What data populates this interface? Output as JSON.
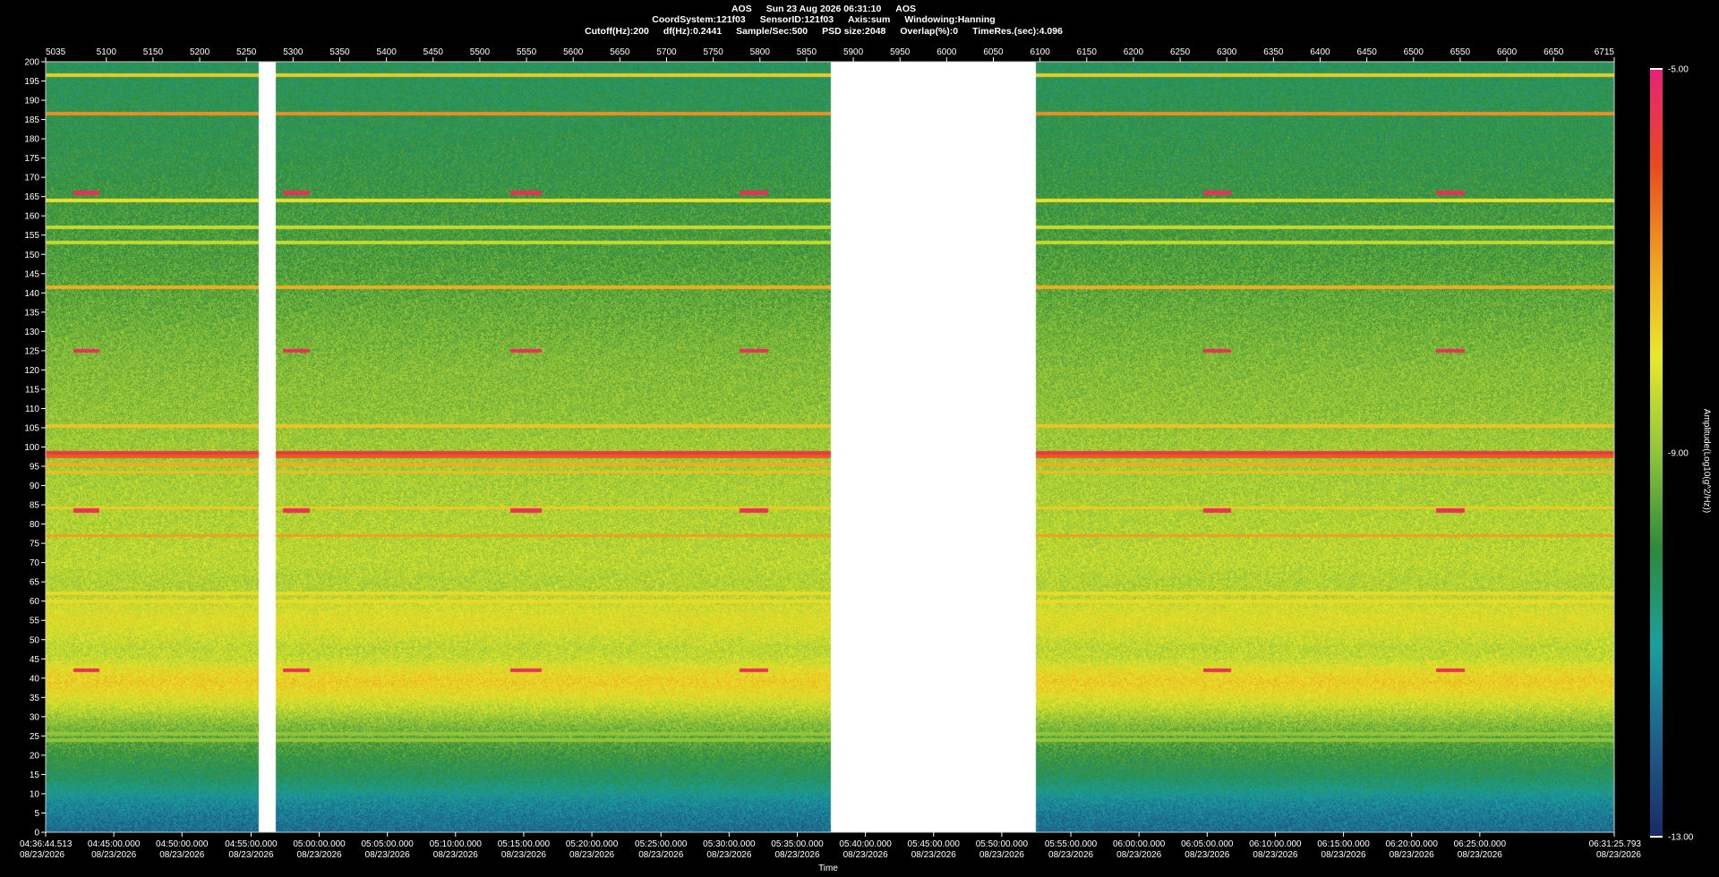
{
  "header": {
    "line1": [
      "AOS",
      "Sun 23 Aug 2026 06:31:10",
      "AOS"
    ],
    "line2": [
      "CoordSystem:121f03",
      "SensorID:121f03",
      "Axis:sum",
      "Windowing:Hanning"
    ],
    "line3": [
      "Cutoff(Hz):200",
      "df(Hz):0.2441",
      "Sample/Sec:500",
      "PSD size:2048",
      "Overlap(%):0",
      "TimeRes.(sec):4.096"
    ]
  },
  "colorbar": {
    "title": "Amplitude(Log10(g^2/Hz))",
    "max_label": "-5.00",
    "mid_label": "-9.00",
    "min_label": "-13.00",
    "stops": [
      "#1a2a66",
      "#1e5f8a",
      "#1aa0a0",
      "#2e8a3a",
      "#8fc43a",
      "#e8e82a",
      "#f0a020",
      "#e84a20",
      "#e8207a"
    ]
  },
  "chart_data": {
    "type": "heatmap",
    "title": "",
    "xlabel": "Time",
    "ylabel": "",
    "ylim": [
      0,
      200
    ],
    "xlim_index": [
      5035,
      6715
    ],
    "y_ticks": [
      0,
      5,
      10,
      15,
      20,
      25,
      30,
      35,
      40,
      45,
      50,
      55,
      60,
      65,
      70,
      75,
      80,
      85,
      90,
      95,
      100,
      105,
      110,
      115,
      120,
      125,
      130,
      135,
      140,
      145,
      150,
      155,
      160,
      165,
      170,
      175,
      180,
      185,
      190,
      195,
      200
    ],
    "top_ticks": [
      5035,
      5100,
      5150,
      5200,
      5250,
      5300,
      5350,
      5400,
      5450,
      5500,
      5550,
      5600,
      5650,
      5700,
      5750,
      5800,
      5850,
      5900,
      5950,
      6000,
      6050,
      6100,
      6150,
      6200,
      6250,
      6300,
      6350,
      6400,
      6450,
      6500,
      6550,
      6600,
      6650,
      6715
    ],
    "bottom_ticks": [
      {
        "index": 5035,
        "time": "04:36:44.513",
        "date": "08/23/2026"
      },
      {
        "index": 5108,
        "time": "04:45:00.000",
        "date": "08/23/2026"
      },
      {
        "index": 5181,
        "time": "04:50:00.000",
        "date": "08/23/2026"
      },
      {
        "index": 5255,
        "time": "04:55:00.000",
        "date": "08/23/2026"
      },
      {
        "index": 5328,
        "time": "05:00:00.000",
        "date": "08/23/2026"
      },
      {
        "index": 5401,
        "time": "05:05:00.000",
        "date": "08/23/2026"
      },
      {
        "index": 5474,
        "time": "05:10:00.000",
        "date": "08/23/2026"
      },
      {
        "index": 5547,
        "time": "05:15:00.000",
        "date": "08/23/2026"
      },
      {
        "index": 5620,
        "time": "05:20:00.000",
        "date": "08/23/2026"
      },
      {
        "index": 5694,
        "time": "05:25:00.000",
        "date": "08/23/2026"
      },
      {
        "index": 5767,
        "time": "05:30:00.000",
        "date": "08/23/2026"
      },
      {
        "index": 5840,
        "time": "05:35:00.000",
        "date": "08/23/2026"
      },
      {
        "index": 5913,
        "time": "05:40:00.000",
        "date": "08/23/2026"
      },
      {
        "index": 5986,
        "time": "05:45:00.000",
        "date": "08/23/2026"
      },
      {
        "index": 6059,
        "time": "05:50:00.000",
        "date": "08/23/2026"
      },
      {
        "index": 6133,
        "time": "05:55:00.000",
        "date": "08/23/2026"
      },
      {
        "index": 6206,
        "time": "06:00:00.000",
        "date": "08/23/2026"
      },
      {
        "index": 6279,
        "time": "06:05:00.000",
        "date": "08/23/2026"
      },
      {
        "index": 6352,
        "time": "06:10:00.000",
        "date": "08/23/2026"
      },
      {
        "index": 6425,
        "time": "06:15:00.000",
        "date": "08/23/2026"
      },
      {
        "index": 6498,
        "time": "06:20:00.000",
        "date": "08/23/2026"
      },
      {
        "index": 6571,
        "time": "06:25:00.000",
        "date": "08/23/2026"
      },
      {
        "index": 6715,
        "time": "06:31:25.793",
        "date": "08/23/2026"
      }
    ],
    "gaps_index": [
      [
        5263,
        5281
      ],
      [
        5876,
        6096
      ]
    ],
    "spectrum_profile_hz": [
      [
        0,
        -11.8
      ],
      [
        4,
        -11.6
      ],
      [
        8,
        -11.3
      ],
      [
        12,
        -10.6
      ],
      [
        16,
        -10.2
      ],
      [
        20,
        -9.9
      ],
      [
        24,
        -9.5
      ],
      [
        28,
        -9.1
      ],
      [
        32,
        -8.5
      ],
      [
        36,
        -7.9
      ],
      [
        39,
        -7.6
      ],
      [
        42,
        -7.9
      ],
      [
        45,
        -8.4
      ],
      [
        48,
        -8.5
      ],
      [
        52,
        -8.2
      ],
      [
        55,
        -8.0
      ],
      [
        58,
        -8.2
      ],
      [
        62,
        -8.6
      ],
      [
        66,
        -8.6
      ],
      [
        70,
        -8.5
      ],
      [
        80,
        -8.6
      ],
      [
        90,
        -8.7
      ],
      [
        100,
        -8.8
      ],
      [
        110,
        -9.0
      ],
      [
        120,
        -9.1
      ],
      [
        130,
        -9.3
      ],
      [
        140,
        -9.5
      ],
      [
        150,
        -9.7
      ],
      [
        160,
        -9.8
      ],
      [
        170,
        -10.0
      ],
      [
        180,
        -10.1
      ],
      [
        190,
        -10.2
      ],
      [
        200,
        -10.3
      ]
    ],
    "lines_hz": [
      {
        "hz": 98.5,
        "level": -5.6
      },
      {
        "hz": 97.6,
        "level": -6.2
      },
      {
        "hz": 95.5,
        "level": -7.2
      },
      {
        "hz": 93.5,
        "level": -7.4
      },
      {
        "hz": 186.5,
        "level": -6.8
      },
      {
        "hz": 196.5,
        "level": -7.6
      },
      {
        "hz": 141.5,
        "level": -7.2
      },
      {
        "hz": 164.0,
        "level": -7.9
      },
      {
        "hz": 157.0,
        "level": -8.4
      },
      {
        "hz": 153.0,
        "level": -8.4
      },
      {
        "hz": 105.5,
        "level": -7.5
      },
      {
        "hz": 84.2,
        "level": -7.6
      },
      {
        "hz": 77.0,
        "level": -7.0
      },
      {
        "hz": 62.0,
        "level": -7.8
      },
      {
        "hz": 60.0,
        "level": -7.8
      },
      {
        "hz": 25.5,
        "level": -9.0
      },
      {
        "hz": 24.0,
        "level": -9.0
      }
    ],
    "events_index": [
      {
        "start": 5065,
        "end": 5093,
        "hz": [
          166,
          125,
          83.5,
          42
        ]
      },
      {
        "start": 5289,
        "end": 5318,
        "hz": [
          166,
          125,
          83.5,
          42
        ]
      },
      {
        "start": 5533,
        "end": 5566,
        "hz": [
          166,
          125,
          83.5,
          42
        ]
      },
      {
        "start": 5778,
        "end": 5809,
        "hz": [
          166,
          125,
          83.5,
          42
        ]
      },
      {
        "start": 6275,
        "end": 6305,
        "hz": [
          166,
          125,
          83.5,
          42
        ]
      },
      {
        "start": 6524,
        "end": 6555,
        "hz": [
          166,
          125,
          83.5,
          42
        ]
      }
    ]
  }
}
